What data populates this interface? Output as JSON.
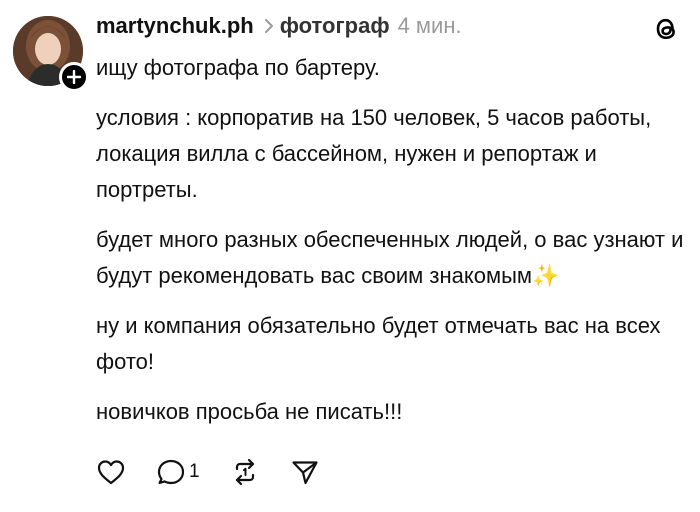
{
  "post": {
    "author": {
      "username": "martynchuk.ph",
      "avatar_icon": "avatar-photo",
      "follow_icon": "plus-icon"
    },
    "topic": "фотограф",
    "time": "4 мин.",
    "app_logo_icon": "threads-logo-icon",
    "paragraphs": [
      "ищу фотографа по бартеру.",
      "условия : корпоратив на 150 человек, 5 часов работы, локация вилла с бассейном, нужен и репортаж и портреты.",
      "будет много разных обеспеченных людей, о вас узнают и будут рекомендовать вас своим знакомым✨",
      "ну и компания обязательно будет отмечать вас на всех фото!",
      "новичков просьба не писать!!!"
    ],
    "actions": {
      "like_icon": "heart-icon",
      "reply_icon": "comment-icon",
      "reply_count": "1",
      "repost_icon": "repost-icon",
      "share_icon": "send-icon"
    }
  }
}
